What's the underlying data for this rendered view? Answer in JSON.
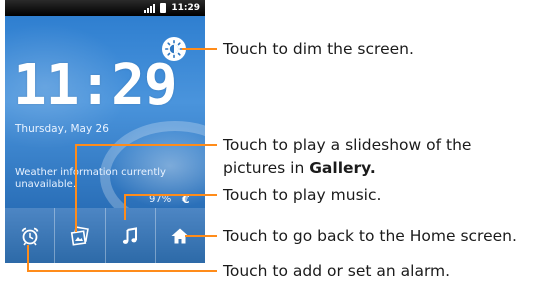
{
  "status_bar": {
    "time": "11:29"
  },
  "lockscreen": {
    "clock": "11:29",
    "date": "Thursday, May 26",
    "weather": "Weather information currently unavailable.",
    "battery_percent": "97%",
    "battery_glyph": "€"
  },
  "dock": {
    "items": [
      {
        "icon": "alarm-clock-icon"
      },
      {
        "icon": "gallery-slideshow-icon"
      },
      {
        "icon": "music-note-icon"
      },
      {
        "icon": "home-icon"
      }
    ]
  },
  "callouts": {
    "dim": "Touch to dim the screen.",
    "slideshow_line1": "Touch to play a slideshow of the",
    "slideshow_line2_prefix": "pictures in ",
    "slideshow_line2_bold": "Gallery.",
    "music": "Touch to play music.",
    "home": "Touch to go back to the Home screen.",
    "alarm": "Touch to add or set an alarm."
  },
  "colors": {
    "leader": "#ff8c1a",
    "wallpaper": "#2e77c2",
    "dock": "#3a78b8"
  }
}
